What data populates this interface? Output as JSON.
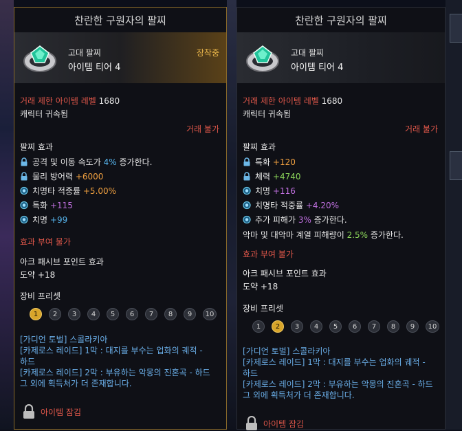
{
  "left": {
    "title": "찬란한 구원자의 팔찌",
    "grade": "고대 팔찌",
    "tier": "아이템 티어 4",
    "equipped": "장착중",
    "trade_limit_label": "거래 제한 아이템 레벨",
    "trade_limit_value": "1680",
    "bound": "캐릭터 귀속됨",
    "trade": "거래 불가",
    "effect_title": "팔찌 효과",
    "effects": [
      {
        "icon": "lock-icon",
        "a": "공격 및 이동 속도가 ",
        "v": "4%",
        "c": "blue",
        "b": " 증가한다."
      },
      {
        "icon": "lock-icon",
        "a": "물리 방어력 ",
        "v": "+6000",
        "c": "orange",
        "b": ""
      },
      {
        "icon": "gem-icon",
        "a": "치명타 적중률 ",
        "v": "+5.00%",
        "c": "orange",
        "b": ""
      },
      {
        "icon": "gem-icon",
        "a": "특화 ",
        "v": "+115",
        "c": "purple",
        "b": ""
      },
      {
        "icon": "gem-icon",
        "a": "치명 ",
        "v": "+99",
        "c": "blue",
        "b": ""
      }
    ],
    "no_grant": "효과 부여 불가",
    "ark_title": "아크 패시브 포인트 효과",
    "ark_value": "도약 +18",
    "preset_title": "장비 프리셋",
    "presets": [
      "1",
      "2",
      "3",
      "4",
      "5",
      "6",
      "7",
      "8",
      "9",
      "10"
    ],
    "active_preset": 0,
    "sources": [
      "[가디언 토벌] 스콜라키아",
      "[카제로스 레이드] 1막 : 대지를 부수는 업화의 궤적 -",
      "하드",
      "[카제로스 레이드] 2막 : 부유하는 악몽의 진혼곡 - 하드",
      "그 외에 획득처가 더 존재합니다."
    ],
    "lock_label": "아이템 잠김"
  },
  "right": {
    "title": "찬란한 구원자의 팔찌",
    "grade": "고대 팔찌",
    "tier": "아이템 티어 4",
    "trade_limit_label": "거래 제한 아이템 레벨",
    "trade_limit_value": "1680",
    "bound": "캐릭터 귀속됨",
    "trade": "거래 불가",
    "effect_title": "팔찌 효과",
    "effects": [
      {
        "icon": "lock-icon",
        "a": "특화 ",
        "v": "+120",
        "c": "orange",
        "b": ""
      },
      {
        "icon": "lock-icon",
        "a": "체력 ",
        "v": "+4740",
        "c": "green",
        "b": ""
      },
      {
        "icon": "gem-icon",
        "a": "치명 ",
        "v": "+116",
        "c": "purple",
        "b": ""
      },
      {
        "icon": "gem-icon",
        "a": "치명타 적중률 ",
        "v": "+4.20%",
        "c": "purple",
        "b": ""
      },
      {
        "icon": "gem-icon",
        "a": "추가 피해가 ",
        "v": "3%",
        "c": "purple",
        "b": " 증가한다."
      }
    ],
    "extra_a": "악마 및 대악마 계열 피해량이 ",
    "extra_v": "2.5%",
    "extra_b": " 증가한다.",
    "no_grant": "효과 부여 불가",
    "ark_title": "아크 패시브 포인트 효과",
    "ark_value": "도약 +18",
    "preset_title": "장비 프리셋",
    "presets": [
      "1",
      "2",
      "3",
      "4",
      "5",
      "6",
      "7",
      "8",
      "9",
      "10"
    ],
    "active_preset": 1,
    "sources": [
      "[가디언 토벌] 스콜라키아",
      "[카제로스 레이드] 1막 : 대지를 부수는 업화의 궤적 -",
      "하드",
      "[카제로스 레이드] 2막 : 부유하는 악몽의 진혼곡 - 하드",
      "그 외에 획득처가 더 존재합니다."
    ],
    "lock_label": "아이템 잠김"
  },
  "colors": {
    "equipped": "#e8b54a",
    "red": "#e0574a",
    "link": "#6aaee8",
    "active_preset": "#d8a52a"
  }
}
